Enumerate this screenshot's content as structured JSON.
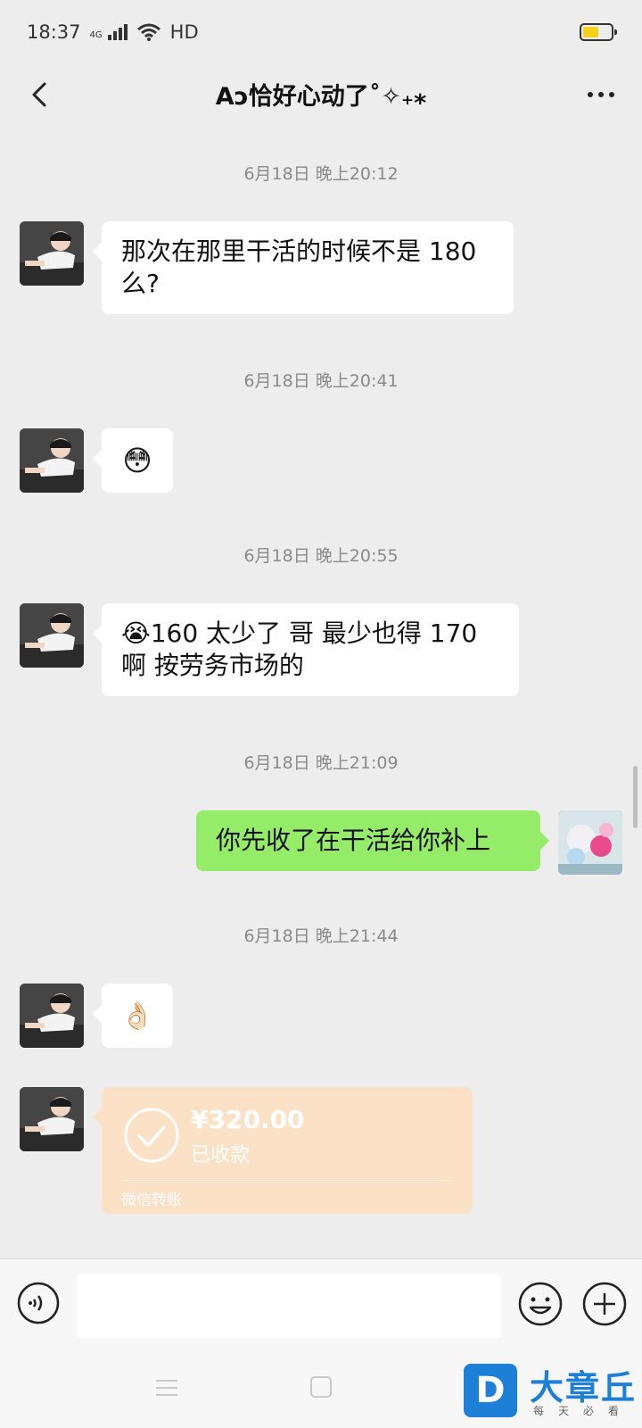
{
  "status_bar": {
    "time": "18:37",
    "network": "4G",
    "hd": "HD"
  },
  "header": {
    "title": "Aↄ恰好心动了˚✧₊⁎"
  },
  "messages": {
    "ts1": "6月18日 晚上20:12",
    "m1": "那次在那里干活的时候不是 180 么?",
    "ts2": "6月18日 晚上20:41",
    "m2_emoji": "😳",
    "ts3": "6月18日 晚上20:55",
    "m3": "😭160 太少了 哥  最少也得 170 啊  按劳务市场的",
    "ts4": "6月18日 晚上21:09",
    "m4": "你先收了在干活给你补上",
    "ts5": "6月18日 晚上21:44",
    "m5_emoji": "👌🏻"
  },
  "transfer": {
    "amount": "¥320.00",
    "status": "已收款",
    "footer": "微信转账"
  },
  "input": {
    "placeholder": ""
  },
  "watermark": {
    "logo": "D",
    "name": "大章丘",
    "slogan": "每天必看"
  }
}
